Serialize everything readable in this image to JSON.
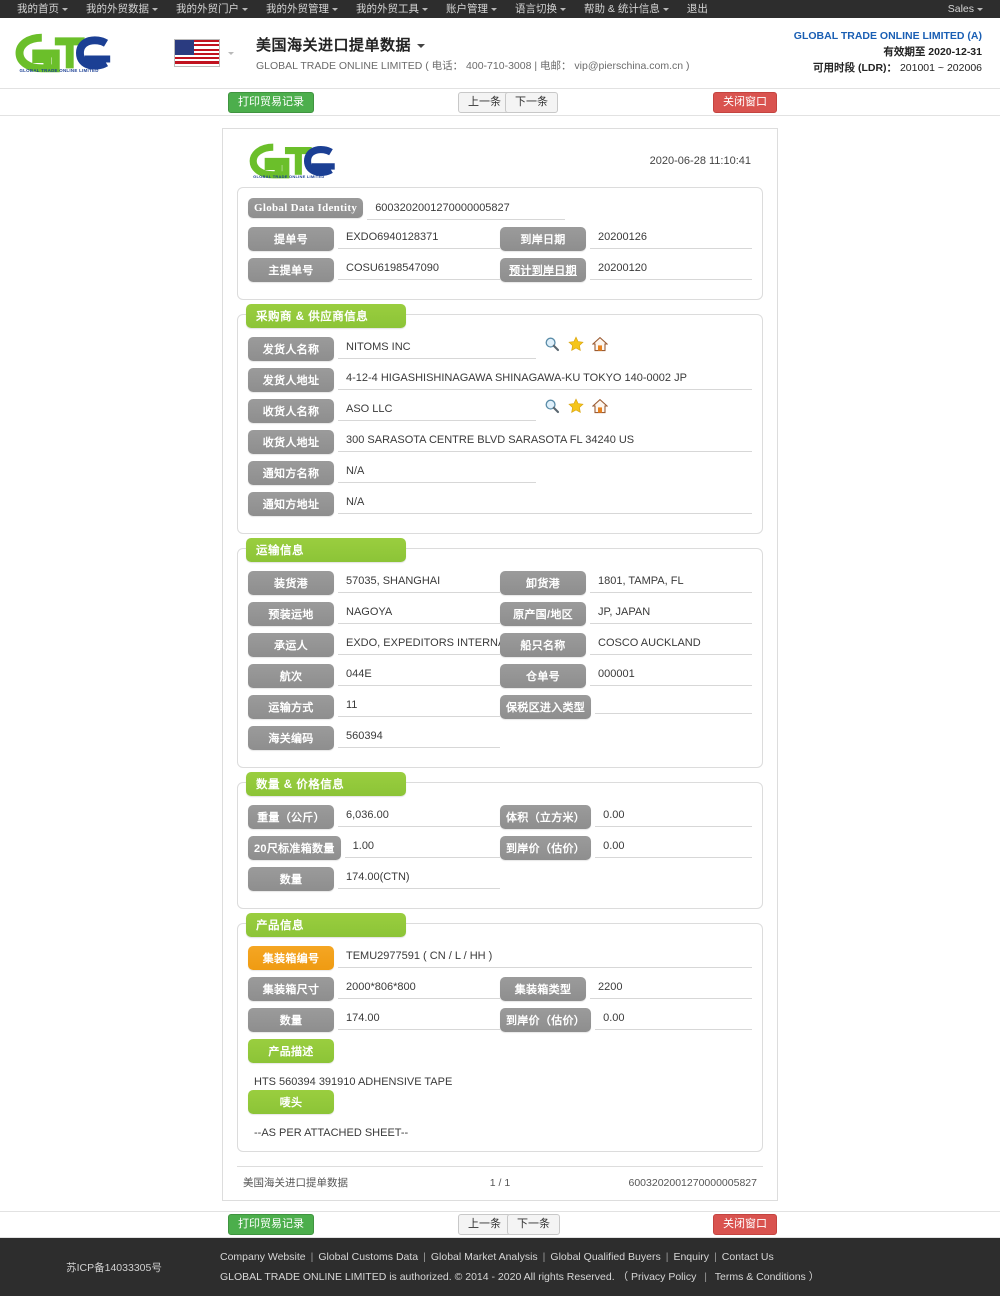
{
  "topnav": {
    "left_items": [
      {
        "label": "我的首页",
        "caret": true
      },
      {
        "label": "我的外贸数据",
        "caret": true
      },
      {
        "label": "我的外贸门户",
        "caret": true
      },
      {
        "label": "我的外贸管理",
        "caret": true
      },
      {
        "label": "我的外贸工具",
        "caret": true
      },
      {
        "label": "账户管理",
        "caret": true
      },
      {
        "label": "语言切换",
        "caret": true
      },
      {
        "label": "帮助 & 统计信息",
        "caret": true
      },
      {
        "label": "退出",
        "caret": false
      }
    ],
    "right_item": {
      "label": "Sales",
      "caret": true
    }
  },
  "header": {
    "logo_text": "GLOBAL TRADE ONLINE LIMITED",
    "flag_name": "us-flag-icon",
    "title": "美国海关进口提单数据",
    "subtitle": "GLOBAL TRADE ONLINE LIMITED ( 电话： 400-710-3008 | 电邮： vip@pierschina.com.cn )",
    "account": "GLOBAL TRADE ONLINE LIMITED (A)",
    "valid_label": "有效期至",
    "valid_value": "2020-12-31",
    "ldr_label": "可用时段 (LDR)：",
    "ldr_value": "201001 ~ 202006"
  },
  "actionbar": {
    "print": "打印贸易记录",
    "prev": "上一条",
    "next": "下一条",
    "close": "关闭窗口"
  },
  "sheet": {
    "logo_text": "GLOBAL TRADE ONLINE LIMITED",
    "timestamp": "2020-06-28 11:10:41",
    "identity": {
      "label": "Global Data Identity",
      "value": "6003202001270000005827"
    },
    "id_fields": [
      {
        "label": "提单号",
        "value": "EXDO6940128371",
        "label2": "到岸日期",
        "value2": "20200126",
        "link2": false
      },
      {
        "label": "主提单号",
        "value": "COSU6198547090",
        "label2": "预计到岸日期",
        "value2": "20200120",
        "link2": true
      }
    ],
    "panels": [
      {
        "title": "采购商 & 供应商信息",
        "rows": [
          {
            "label": "发货人名称",
            "value": "NITOMS INC",
            "short": true,
            "icons": true
          },
          {
            "label": "发货人地址",
            "value": "4-12-4 HIGASHISHINAGAWA SHINAGAWA-KU TOKYO 140-0002 JP",
            "short": false,
            "icons": false
          },
          {
            "label": "收货人名称",
            "value": "ASO LLC",
            "short": true,
            "icons": true
          },
          {
            "label": "收货人地址",
            "value": "300 SARASOTA CENTRE BLVD SARASOTA FL 34240 US",
            "short": false,
            "icons": false
          },
          {
            "label": "通知方名称",
            "value": "N/A",
            "short": true,
            "icons": false
          },
          {
            "label": "通知方地址",
            "value": "N/A",
            "short": false,
            "icons": false
          }
        ]
      },
      {
        "title": "运输信息",
        "pairs": [
          {
            "label": "装货港",
            "value": "57035, SHANGHAI",
            "label2": "卸货港",
            "value2": "1801, TAMPA, FL"
          },
          {
            "label": "预装运地",
            "value": "NAGOYA",
            "label2": "原产国/地区",
            "value2": "JP, JAPAN"
          },
          {
            "label": "承运人",
            "value": "EXDO, EXPEDITORS INTERNATIONAL",
            "label2": "船只名称",
            "value2": "COSCO AUCKLAND"
          },
          {
            "label": "航次",
            "value": "044E",
            "label2": "仓单号",
            "value2": "000001"
          },
          {
            "label": "运输方式",
            "value": "11",
            "label2": "保税区进入类型",
            "value2": ""
          },
          {
            "label": "海关编码",
            "value": "560394",
            "label2": "",
            "value2": ""
          }
        ]
      },
      {
        "title": "数量 & 价格信息",
        "pairs": [
          {
            "label": "重量（公斤）",
            "value": "6,036.00",
            "label2": "体积（立方米）",
            "value2": "0.00"
          },
          {
            "label": "20尺标准箱数量",
            "value": "1.00",
            "label2": "到岸价（估价）",
            "value2": "0.00"
          },
          {
            "label": "数量",
            "value": "174.00(CTN)",
            "label2": "",
            "value2": ""
          }
        ]
      }
    ],
    "product": {
      "title": "产品信息",
      "container_label": "集装箱编号",
      "container_value": "TEMU2977591 ( CN / L / HH )",
      "pairs": [
        {
          "label": "集装箱尺寸",
          "value": "2000*806*800",
          "label2": "集装箱类型",
          "value2": "2200"
        },
        {
          "label": "数量",
          "value": "174.00",
          "label2": "到岸价（估价）",
          "value2": "0.00"
        }
      ],
      "desc_label": "产品描述",
      "desc_value": "HTS 560394 391910 ADHENSIVE TAPE",
      "mark_label": "唛头",
      "mark_value": "--AS PER ATTACHED SHEET--"
    },
    "footer": {
      "left": "美国海关进口提单数据",
      "middle": "1 / 1",
      "right": "6003202001270000005827"
    }
  },
  "icons": {
    "search": "search-icon",
    "star": "star-icon",
    "home": "home-icon"
  },
  "sitefooter": {
    "icp": "苏ICP备14033305号",
    "links": [
      "Company Website",
      "Global Customs Data",
      "Global Market Analysis",
      "Global Qualified Buyers",
      "Enquiry",
      "Contact Us"
    ],
    "copyright": "GLOBAL TRADE ONLINE LIMITED is authorized. © 2014 - 2020 All rights Reserved.",
    "policy_open": "（",
    "privacy": "Privacy Policy",
    "terms": "Terms & Conditions",
    "policy_close": "）"
  },
  "colors": {
    "green": "#8cc437",
    "orange": "#ef9b12",
    "gray_pill": "#8e8e8e",
    "nav_bg": "#2d2d2d",
    "link_blue": "#1a5fb4",
    "btn_green": "#4cae4c",
    "btn_red": "#d9534f"
  }
}
